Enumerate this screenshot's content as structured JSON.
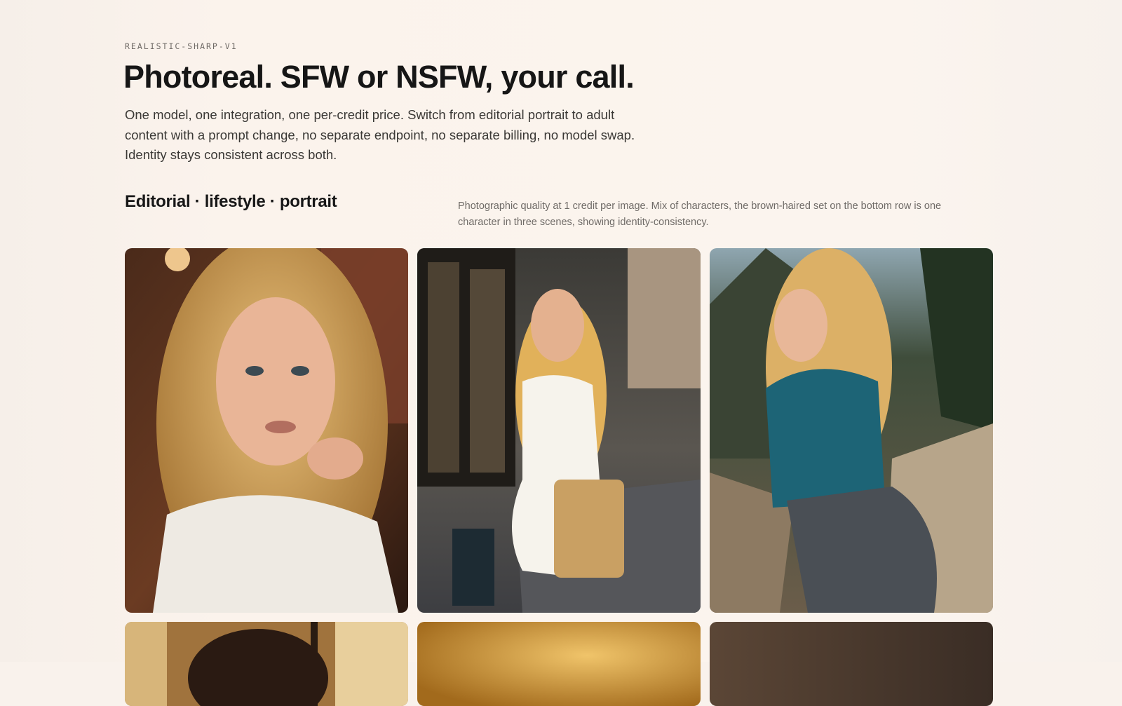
{
  "header": {
    "eyebrow": "REALISTIC-SHARP-V1",
    "title": "Photoreal. SFW or NSFW, your call.",
    "description": "One model, one integration, one per-credit price. Switch from editorial portrait to adult content with a prompt change, no separate endpoint, no separate billing, no model swap. Identity stays consistent across both."
  },
  "section": {
    "title": "Editorial · lifestyle · portrait",
    "note": "Photographic quality at 1 credit per image. Mix of characters, the brown-haired set on the bottom row is one character in three scenes, showing identity-consistency."
  },
  "gallery": [
    {
      "name": "cafe-portrait-image"
    },
    {
      "name": "street-dress-image"
    },
    {
      "name": "mountain-hike-image"
    },
    {
      "name": "window-portrait-image"
    },
    {
      "name": "warm-bokeh-image"
    },
    {
      "name": "dark-portrait-image"
    }
  ]
}
